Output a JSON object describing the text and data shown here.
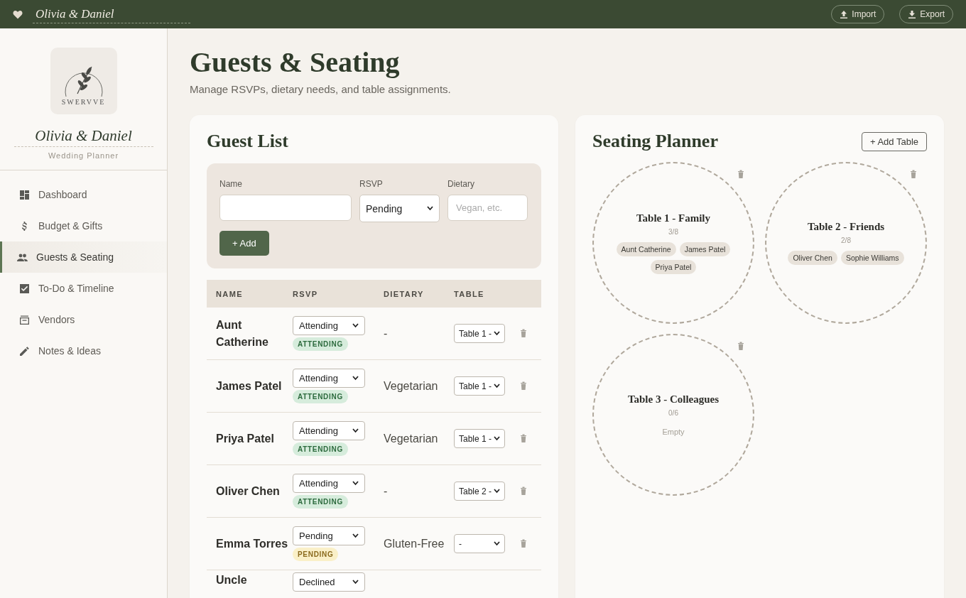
{
  "topbar": {
    "title": "Olivia & Daniel",
    "buttons": [
      {
        "label": "Import",
        "kind": "import"
      },
      {
        "label": "Export",
        "kind": "export"
      }
    ]
  },
  "sidebar": {
    "logo": {
      "wordmark": "SWERVVE"
    },
    "couple": "Olivia & Daniel",
    "subtitle": "Wedding Planner",
    "items": [
      {
        "label": "Dashboard",
        "kind": "dashboard",
        "selected": false
      },
      {
        "label": "Budget & Gifts",
        "kind": "dollar",
        "selected": false
      },
      {
        "label": "Guests & Seating",
        "kind": "people",
        "selected": true
      },
      {
        "label": "To-Do & Timeline",
        "kind": "checkbox",
        "selected": false
      },
      {
        "label": "Vendors",
        "kind": "vendor",
        "selected": false
      },
      {
        "label": "Notes & Ideas",
        "kind": "pencil",
        "selected": false
      }
    ]
  },
  "page": {
    "title": "Guests & Seating",
    "subtitle": "Manage RSVPs, dietary needs, and table assignments."
  },
  "guest_list": {
    "title": "Guest List",
    "form": {
      "name_label": "Name",
      "rsvp_label": "RSVP",
      "rsvp_value": "Pending",
      "dietary_label": "Dietary",
      "dietary_placeholder": "Vegan, etc.",
      "add_button": "+ Add"
    },
    "columns": [
      "NAME",
      "RSVP",
      "DIETARY",
      "TABLE"
    ],
    "rows": [
      {
        "name": "Aunt Catherine",
        "rsvp": "Attending",
        "kind": "attending",
        "badge": "ATTENDING",
        "dietary": "-",
        "table": "Table 1 -"
      },
      {
        "name": "James Patel",
        "rsvp": "Attending",
        "kind": "attending",
        "badge": "ATTENDING",
        "dietary": "Vegetarian",
        "table": "Table 1 -"
      },
      {
        "name": "Priya Patel",
        "rsvp": "Attending",
        "kind": "attending",
        "badge": "ATTENDING",
        "dietary": "Vegetarian",
        "table": "Table 1 -"
      },
      {
        "name": "Oliver Chen",
        "rsvp": "Attending",
        "kind": "attending",
        "badge": "ATTENDING",
        "dietary": "-",
        "table": "Table 2 -"
      },
      {
        "name": "Emma Torres",
        "rsvp": "Pending",
        "kind": "pending",
        "badge": "PENDING",
        "dietary": "Gluten-Free",
        "table": "-"
      },
      {
        "name": "Uncle",
        "rsvp": "Declined"
      }
    ]
  },
  "seating": {
    "title": "Seating Planner",
    "add_button": "+ Add Table",
    "tables": [
      {
        "name": "Table 1 - Family",
        "count": "3/8",
        "guests": [
          "Aunt Catherine",
          "James Patel",
          "Priya Patel"
        ]
      },
      {
        "name": "Table 2 - Friends",
        "count": "2/8",
        "guests": [
          "Oliver Chen",
          "Sophie Williams"
        ]
      },
      {
        "name": "Table 3 - Colleagues",
        "count": "0/6",
        "empty_text": "Empty"
      }
    ]
  }
}
